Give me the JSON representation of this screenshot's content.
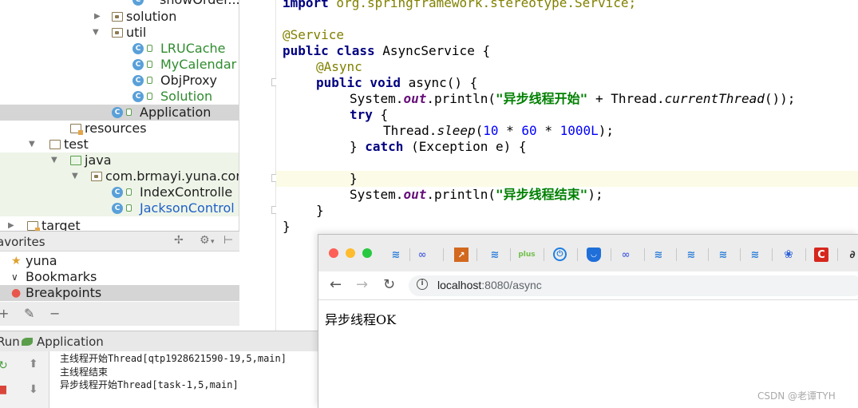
{
  "project_tree": {
    "rows": [
      {
        "label": "showOrder...",
        "kind": "class"
      },
      {
        "label": "solution",
        "kind": "package"
      },
      {
        "label": "util",
        "kind": "package"
      },
      {
        "label": "LRUCache",
        "kind": "class"
      },
      {
        "label": "MyCalendar",
        "kind": "class"
      },
      {
        "label": "ObjProxy",
        "kind": "class"
      },
      {
        "label": "Solution",
        "kind": "class"
      },
      {
        "label": "Application",
        "kind": "app-class"
      },
      {
        "label": "resources",
        "kind": "resources-folder"
      },
      {
        "label": "test",
        "kind": "folder"
      },
      {
        "label": "java",
        "kind": "test-source-folder"
      },
      {
        "label": "com.brmayi.yuna.cor",
        "kind": "package"
      },
      {
        "label": "IndexControlle",
        "kind": "class"
      },
      {
        "label": "JacksonControl",
        "kind": "class"
      },
      {
        "label": "target",
        "kind": "folder"
      }
    ]
  },
  "favorites": {
    "title": "avorites",
    "items": [
      {
        "label": "yuna",
        "icon": "star-icon"
      },
      {
        "label": "Bookmarks",
        "icon": "chevron-icon"
      },
      {
        "label": "Breakpoints",
        "icon": "breakpoint-icon"
      }
    ],
    "toolbar": {
      "add": "+",
      "edit": "✎",
      "remove": "−"
    }
  },
  "run_panel": {
    "label": "Run",
    "app": "Application",
    "console": [
      "主线程开始Thread[qtp1928621590-19,5,main]",
      "主线程结束",
      "异步线程开始Thread[task-1,5,main]"
    ]
  },
  "editor": {
    "lines": {
      "l0_kw": "import",
      "l0_rest": " org.springframework.stereotype.Service;",
      "l2": "@Service",
      "l3_kw": "public class",
      "l3_rest": " AsyncService {",
      "l4": "@Async",
      "l5_kw": "public void",
      "l5_rest": " async() {",
      "l6_a": "System.",
      "l6_out": "out",
      "l6_b": ".println(",
      "l6_str": "\"异步线程开始\"",
      "l6_c": " + Thread.",
      "l6_ital": "currentThread",
      "l6_d": "());",
      "l7_kw": "try",
      "l7_rest": " {",
      "l8_a": "Thread.",
      "l8_ital": "sleep",
      "l8_b": "(",
      "l8_n1": "10",
      "l8_c": " * ",
      "l8_n2": "60",
      "l8_d": " * ",
      "l8_n3": "1000L",
      "l8_e": ");",
      "l9_a": "} ",
      "l9_kw": "catch",
      "l9_rest": " (Exception e) {",
      "l11": "}",
      "l12_a": "System.",
      "l12_out": "out",
      "l12_b": ".println(",
      "l12_str": "\"异步线程结束\"",
      "l12_c": ");",
      "l13": "}",
      "l14": "}"
    }
  },
  "browser": {
    "url_host": "localhost",
    "url_path": ":8080/async",
    "info_icon": "i",
    "page_text": "异步线程OK",
    "bookmarks": [
      "bm-meituan",
      "bm-oo",
      "bm-chart",
      "bm-meituan",
      "bm-plus",
      "bm-power",
      "bm-shield",
      "bm-oo",
      "bm-meituan",
      "bm-meituan",
      "bm-meituan",
      "bm-meituan",
      "bm-baidu",
      "bm-csdn"
    ],
    "plus_label": "plus",
    "csdn_label": "C"
  },
  "watermark": "CSDN @老谭TYH"
}
